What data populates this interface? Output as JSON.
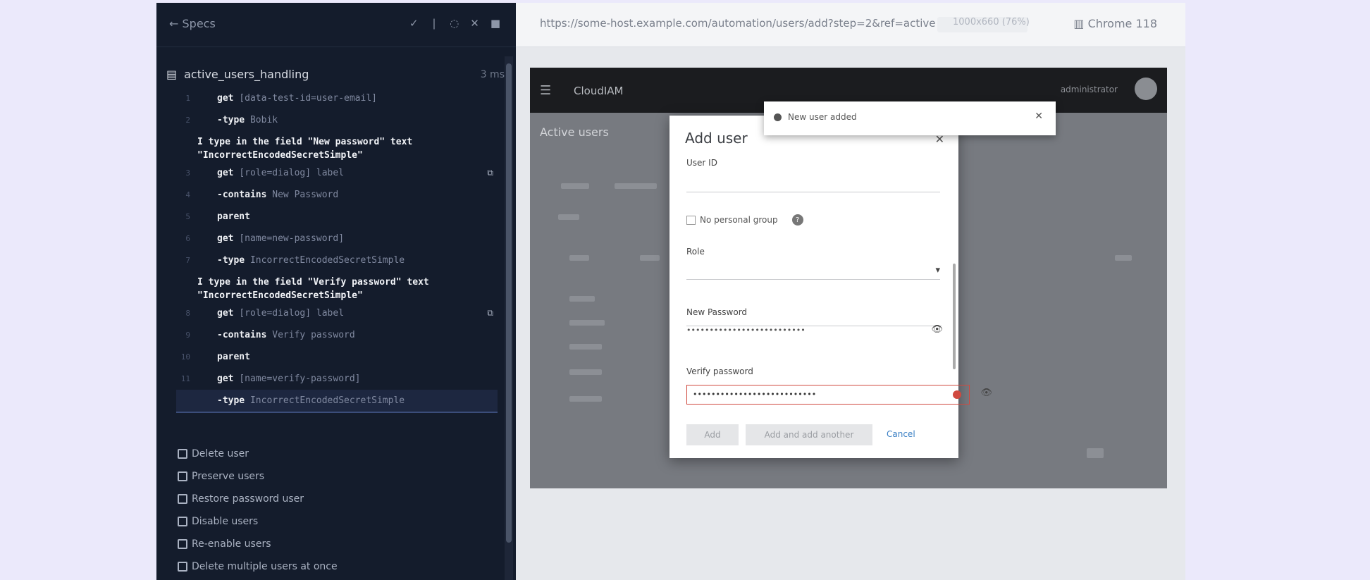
{
  "runner": {
    "back_label": "Specs",
    "toolbar_icons": [
      "checkmark-icon",
      "stats-icon",
      "spinner-icon",
      "close-icon",
      "stop-icon"
    ],
    "spec_name": "active_users_handling",
    "spec_meta": "3 ms",
    "code_lines": [
      {
        "kind": "cmd",
        "num": "1",
        "cmd": "get",
        "arg": "[data-test-id=user-email]"
      },
      {
        "kind": "cmd",
        "num": "2",
        "cmd": "-type",
        "arg": "Bobik"
      },
      {
        "kind": "step",
        "text": "I type in the field \"New password\" text \"IncorrectEncodedSecretSimple\""
      },
      {
        "kind": "cmd",
        "num": "3",
        "cmd": "get",
        "arg": "[role=dialog] label",
        "icon": "pin-icon"
      },
      {
        "kind": "cmd",
        "num": "4",
        "cmd": "-contains",
        "arg": "New Password"
      },
      {
        "kind": "cmd",
        "num": "5",
        "cmd": "parent",
        "arg": ""
      },
      {
        "kind": "cmd",
        "num": "6",
        "cmd": "get",
        "arg": "[name=new-password]"
      },
      {
        "kind": "cmd",
        "num": "7",
        "cmd": "-type",
        "arg": "IncorrectEncodedSecretSimple"
      },
      {
        "kind": "step",
        "text": "I type in the field \"Verify password\" text \"IncorrectEncodedSecretSimple\""
      },
      {
        "kind": "cmd",
        "num": "8",
        "cmd": "get",
        "arg": "[role=dialog] label",
        "icon": "pin-icon"
      },
      {
        "kind": "cmd",
        "num": "9",
        "cmd": "-contains",
        "arg": "Verify password"
      },
      {
        "kind": "cmd",
        "num": "10",
        "cmd": "parent",
        "arg": ""
      },
      {
        "kind": "cmd",
        "num": "11",
        "cmd": "get",
        "arg": "[name=verify-password]"
      },
      {
        "kind": "active",
        "num": "",
        "cmd": "-type",
        "arg": "IncorrectEncodedSecretSimple"
      }
    ],
    "commands": [
      "Delete user",
      "Preserve users",
      "Restore password user",
      "Disable users",
      "Re-enable users",
      "Delete multiple users at once"
    ]
  },
  "browser": {
    "url": "https://some-host.example.com/automation/users/add?step=2&ref=active",
    "viewport_label": "1000x660 (76%)",
    "browser_label": "Chrome 118"
  },
  "aut": {
    "brand": "CloudIAM",
    "user_name": "administrator",
    "page_title": "Active users"
  },
  "dialog": {
    "title": "Add user",
    "user_id_label": "User ID",
    "user_id_value": "",
    "private_group_label": "No personal group",
    "role_label": "Role",
    "role_value": "",
    "new_password_label": "New Password",
    "new_password_value": "••••••••••••••••••••••••••",
    "verify_password_label": "Verify password",
    "verify_password_value": "•••••••••••••••••••••••••••",
    "add_label": "Add",
    "add_another_label": "Add and add another",
    "cancel_label": "Cancel"
  },
  "toast": {
    "message": "New user added"
  },
  "colors": {
    "runner_bg": "#141c2c",
    "error": "#d0493f",
    "link": "#3a7fc4",
    "page_bg": "#ebe9fb"
  }
}
